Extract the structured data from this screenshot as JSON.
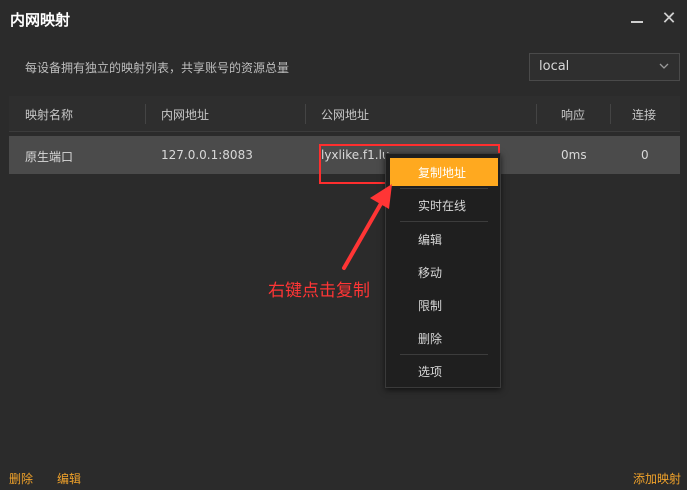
{
  "window": {
    "title": "内网映射",
    "minimize_symbol": "—",
    "close_symbol": "✕"
  },
  "description": "每设备拥有独立的映射列表，共享账号的资源总量",
  "region_select": {
    "value": "local"
  },
  "table": {
    "headers": [
      "映射名称",
      "内网地址",
      "公网地址",
      "响应",
      "连接"
    ],
    "rows": [
      {
        "name": "原生端口",
        "local_addr": "127.0.0.1:8083",
        "public_addr": "lyxlike.f1.lu",
        "response": "0ms",
        "connections": "0"
      }
    ]
  },
  "context_menu": {
    "items": [
      "复制地址",
      "实时在线",
      "编辑",
      "移动",
      "限制",
      "删除",
      "选项"
    ],
    "active_index": 0
  },
  "annotation": {
    "text": "右键点击复制",
    "color": "#ff3535"
  },
  "footer": {
    "delete": "删除",
    "edit": "编辑",
    "add": "添加映射"
  },
  "colors": {
    "accent": "#ffa91f",
    "link": "#f0a22a",
    "highlight": "#ff2e2e"
  }
}
